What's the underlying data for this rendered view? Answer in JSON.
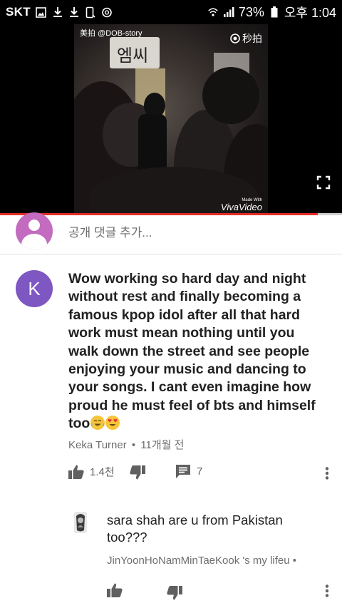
{
  "status_bar": {
    "carrier": "SKT",
    "battery": "73%",
    "time": "오후 1:04",
    "left_icons": [
      "image-icon",
      "download-icon",
      "download-icon",
      "tablet-icon",
      "alarm-icon"
    ],
    "right_icons": [
      "wifi-icon",
      "signal-icon",
      "battery-icon"
    ]
  },
  "video": {
    "watermark": "美拍 @DOB-story",
    "sign_text": "엠씨",
    "app_logo": "秒拍",
    "made_with": "Made With",
    "brand": "VivaVideo",
    "progress": 0.93,
    "progress_color": "#e52d27"
  },
  "add_comment": {
    "placeholder": "공개 댓글 추가..."
  },
  "comment": {
    "avatar_letter": "K",
    "avatar_color": "#7e57c2",
    "text": "Wow working so hard day and night without rest and finally becoming a famous kpop idol after all that hard work must mean nothing until you walk down the street and see people enjoying your music and dancing to your songs. I cant even imagine how proud he must feel of bts and himself too",
    "emojis": [
      "tears-of-joy-emoji",
      "heart-eyes-emoji"
    ],
    "author": "Keka Turner",
    "separator": "•",
    "time_ago": "11개월 전",
    "likes": "1.4천",
    "replies": "7"
  },
  "reply": {
    "text": "sara shah are u from Pakistan too???",
    "author_line": "JinYoonHoNamMinTaeKook 's my lifeu •"
  }
}
